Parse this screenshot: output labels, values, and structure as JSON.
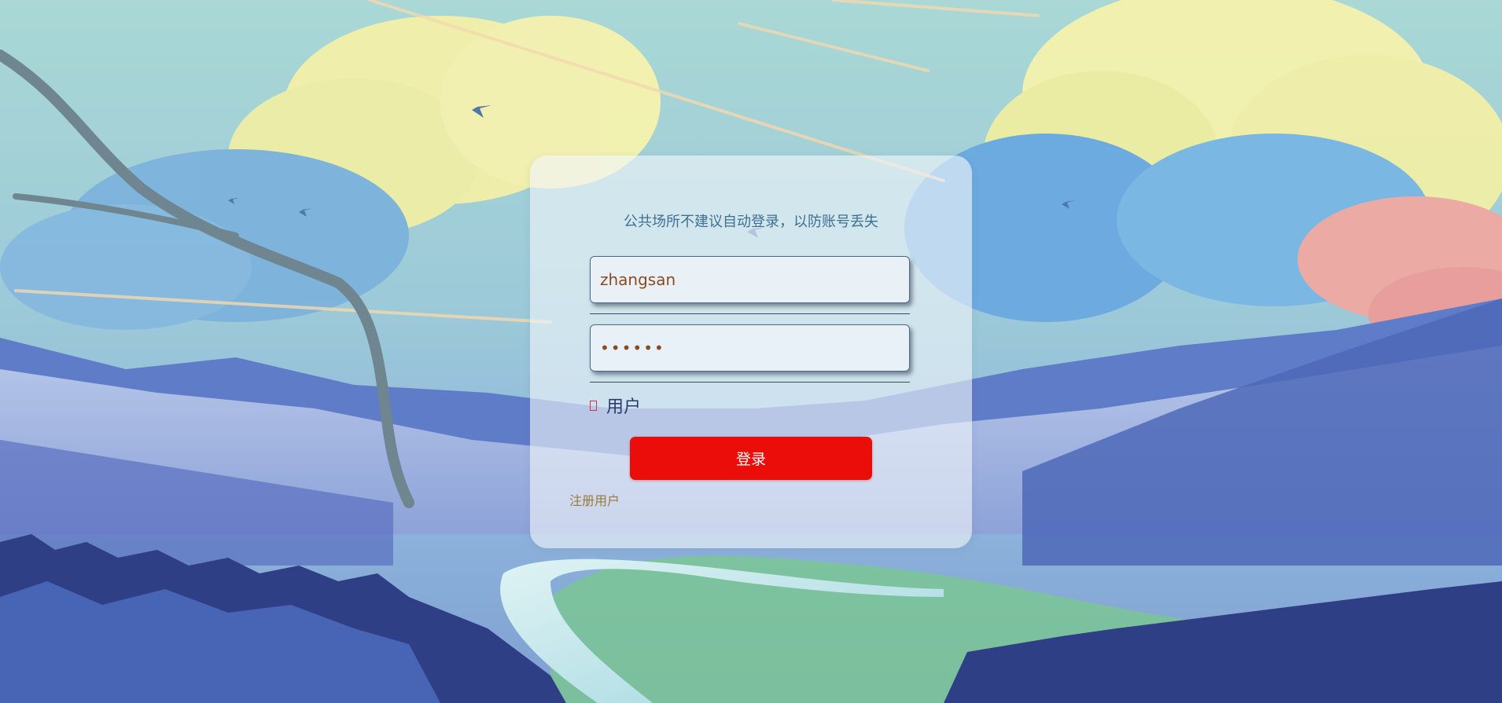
{
  "login": {
    "notice": "公共场所不建议自动登录，以防账号丢失",
    "username": {
      "value": "zhangsan",
      "placeholder": ""
    },
    "password": {
      "value": "111111",
      "placeholder": ""
    },
    "role_label": "用户",
    "submit_label": "登录",
    "register_label": "注册用户"
  },
  "colors": {
    "button": "#ea0d0a",
    "notice_text": "#3f6f92",
    "input_text": "#8a4a22",
    "role_text": "#283a6e",
    "link_text": "#9a7a38"
  }
}
